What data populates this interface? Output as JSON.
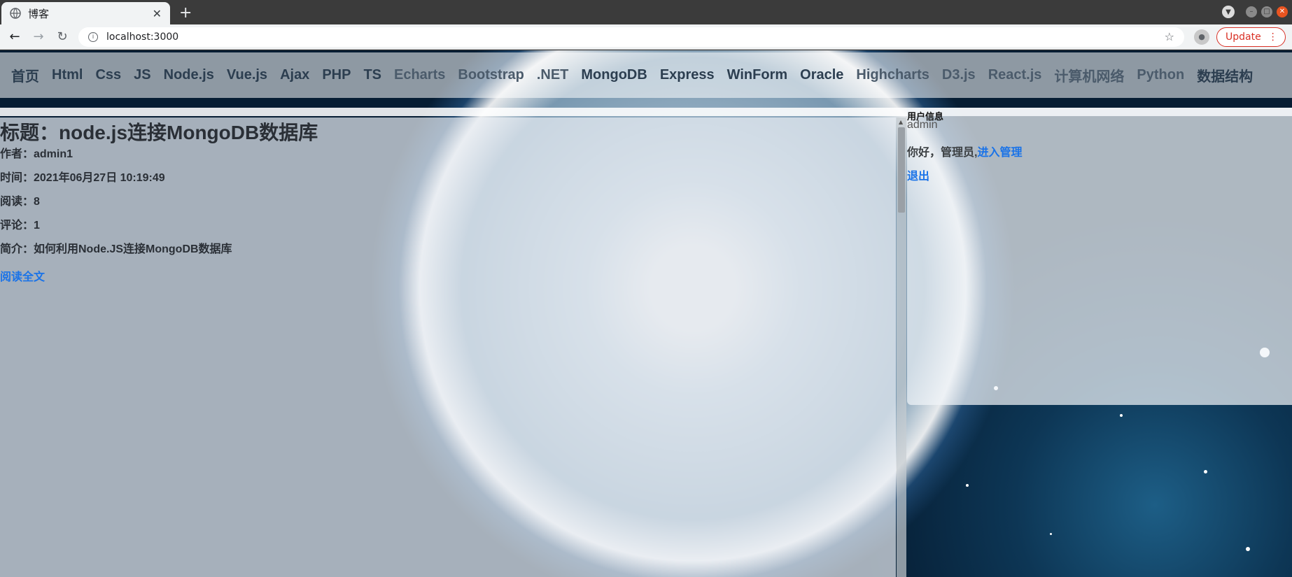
{
  "browser": {
    "tab_title": "博客",
    "url": "localhost:3000",
    "update_label": "Update"
  },
  "nav": {
    "items": [
      "首页",
      "Html",
      "Css",
      "JS",
      "Node.js",
      "Vue.js",
      "Ajax",
      "PHP",
      "TS",
      "Echarts",
      "Bootstrap",
      ".NET",
      "MongoDB",
      "Express",
      "WinForm",
      "Oracle",
      "Highcharts",
      "D3.js",
      "React.js",
      "计算机网络",
      "Python",
      "数据结构"
    ]
  },
  "post": {
    "title": "标题：node.js连接MongoDB数据库",
    "author": "作者：admin1",
    "time": "时间：2021年06月27日 10:19:49",
    "reads": "阅读：8",
    "comments": "评论：1",
    "summary": "简介：如何利用Node.JS连接MongoDB数据库",
    "read_more": "阅读全文"
  },
  "user_panel": {
    "heading": "用户信息",
    "username": "admin",
    "greeting": "你好，管理员,",
    "admin_link": "进入管理",
    "logout": "退出"
  },
  "colors": {
    "link": "#1a73e8",
    "update_red": "#d93025",
    "close_orange": "#e95420"
  },
  "icons": [
    "globe-icon",
    "close-icon",
    "plus-icon",
    "back-icon",
    "forward-icon",
    "reload-icon",
    "info-icon",
    "star-icon",
    "profile-icon",
    "more-icon",
    "minimize-icon",
    "maximize-icon",
    "window-close-icon"
  ]
}
